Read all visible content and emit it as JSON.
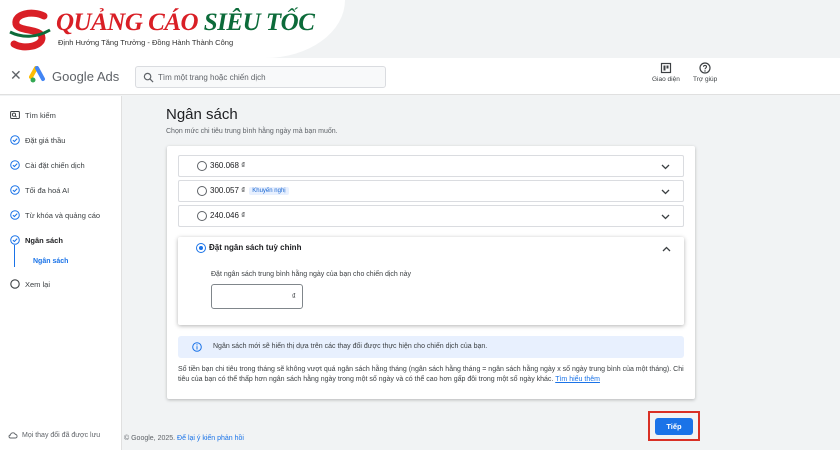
{
  "watermark": {
    "brand_primary": "QUẢNG CÁO",
    "brand_secondary": "SIÊU TỐC",
    "tagline": "Định Hướng Tăng Trưởng - Đồng Hành Thành Công",
    "colors": {
      "red": "#d91f26",
      "green": "#0c6b3a"
    }
  },
  "header": {
    "close_label": "✕",
    "app_name": "Google Ads",
    "search_placeholder": "Tìm một trang hoặc chiến dịch",
    "appearance_label": "Giao diện",
    "help_label": "Trợ giúp"
  },
  "sidebar": {
    "items": [
      {
        "label": "Tìm kiếm",
        "icon": "search-box-icon"
      },
      {
        "label": "Đặt giá thầu",
        "icon": "check-circle-icon"
      },
      {
        "label": "Cài đặt chiến dịch",
        "icon": "check-circle-icon"
      },
      {
        "label": "Tối đa hoá AI",
        "icon": "check-circle-icon"
      },
      {
        "label": "Từ khóa và quảng cáo",
        "icon": "check-circle-icon"
      },
      {
        "label": "Ngân sách",
        "icon": "check-circle-icon"
      },
      {
        "label": "Xem lại",
        "icon": "empty-circle-icon"
      }
    ],
    "sub_item": "Ngân sách",
    "footer": "Mọi thay đổi đã được lưu"
  },
  "main": {
    "title": "Ngân sách",
    "description": "Chọn mức chi tiêu trung bình hằng ngày mà bạn muốn.",
    "options": [
      {
        "label": "360.068 ₫",
        "badge": ""
      },
      {
        "label": "300.057 ₫",
        "badge": "Khuyến nghị"
      },
      {
        "label": "240.046 ₫",
        "badge": ""
      }
    ],
    "custom": {
      "label": "Đặt ngân sách tuỳ chỉnh",
      "field_label": "Đặt ngân sách trung bình hằng ngày của bạn cho chiến dịch này",
      "value": "",
      "currency": "₫",
      "selected": true
    },
    "info": "Ngân sách mới sẽ hiển thị dựa trên các thay đổi được thực hiện cho chiến dịch của bạn.",
    "note": "Số tiền bạn chi tiêu trong tháng sẽ không vượt quá ngân sách hằng tháng (ngân sách hằng tháng = ngân sách hằng ngày x số ngày trung bình của một tháng). Chi tiêu của bạn có thể thấp hơn ngân sách hằng ngày trong một số ngày và có thể cao hơn gấp đôi trong một số ngày khác.",
    "note_link": "Tìm hiểu thêm"
  },
  "footer": {
    "copyright": "© Google, 2025.",
    "feedback_link": "Để lại ý kiến phản hồi"
  },
  "next_button": "Tiếp",
  "colors": {
    "accent": "#1a73e8",
    "highlight_border": "#d93025"
  }
}
